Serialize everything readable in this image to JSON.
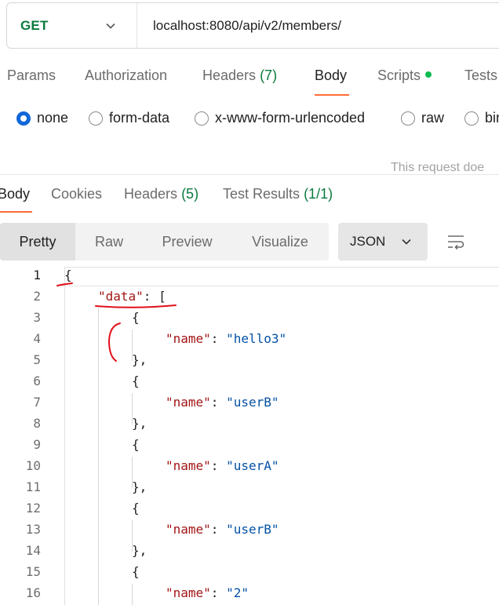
{
  "request": {
    "method": "GET",
    "url": "localhost:8080/api/v2/members/"
  },
  "request_tabs": [
    {
      "label": "Params"
    },
    {
      "label": "Authorization"
    },
    {
      "label": "Headers",
      "count": "(7)"
    },
    {
      "label": "Body",
      "active": true
    },
    {
      "label": "Scripts",
      "indicator": "green-dot"
    },
    {
      "label": "Tests"
    }
  ],
  "body_types": [
    {
      "label": "none",
      "selected": true
    },
    {
      "label": "form-data"
    },
    {
      "label": "x-www-form-urlencoded"
    },
    {
      "label": "raw"
    },
    {
      "label": "bin"
    }
  ],
  "body_hint": "This request doe",
  "response_tabs": [
    {
      "label": "Body",
      "active": true
    },
    {
      "label": "Cookies"
    },
    {
      "label": "Headers",
      "count": "(5)"
    },
    {
      "label": "Test Results",
      "count": "(1/1)"
    }
  ],
  "view_modes": [
    "Pretty",
    "Raw",
    "Preview",
    "Visualize"
  ],
  "active_view": "Pretty",
  "format": "JSON",
  "code_lines": [
    {
      "n": "1",
      "text": "{"
    },
    {
      "n": "2",
      "key": "\"data\"",
      "after": ": ["
    },
    {
      "n": "3",
      "text": "{"
    },
    {
      "n": "4",
      "key": "\"name\"",
      "value": "\"hello3\""
    },
    {
      "n": "5",
      "text": "},"
    },
    {
      "n": "6",
      "text": "{"
    },
    {
      "n": "7",
      "key": "\"name\"",
      "value": "\"userB\""
    },
    {
      "n": "8",
      "text": "},"
    },
    {
      "n": "9",
      "text": "{"
    },
    {
      "n": "10",
      "key": "\"name\"",
      "value": "\"userA\""
    },
    {
      "n": "11",
      "text": "},"
    },
    {
      "n": "12",
      "text": "{"
    },
    {
      "n": "13",
      "key": "\"name\"",
      "value": "\"userB\""
    },
    {
      "n": "14",
      "text": "},"
    },
    {
      "n": "15",
      "text": "{"
    },
    {
      "n": "16",
      "key": "\"name\"",
      "value": "\"2\""
    }
  ],
  "colors": {
    "method": "#0b7a3e",
    "accent": "#ff6c37",
    "radio_selected": "#1167d9",
    "json_key": "#a31515",
    "json_string": "#0451a5",
    "annotation": "#e0101a"
  }
}
